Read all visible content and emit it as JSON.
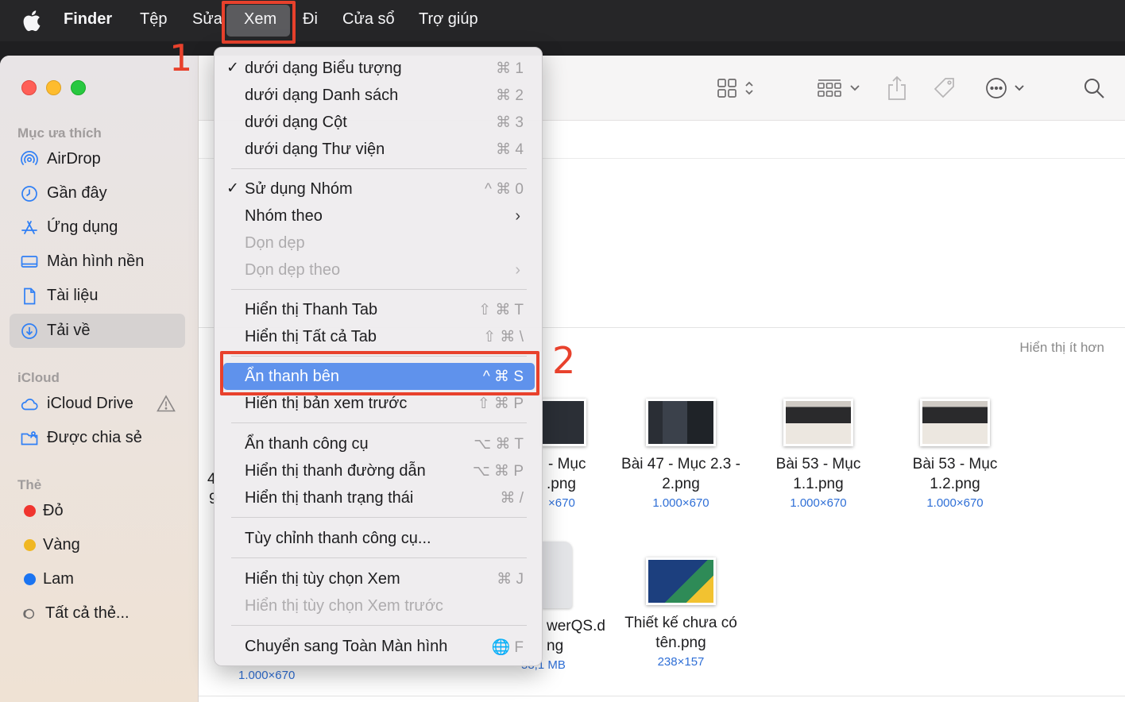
{
  "menubar": {
    "app": "Finder",
    "items": [
      "Tệp",
      "Sửa",
      "Xem",
      "Đi",
      "Cửa sổ",
      "Trợ giúp"
    ]
  },
  "annotations": {
    "step1": "1",
    "step2": "2",
    "accent_color": "#e8412c"
  },
  "sidebar": {
    "favorites_title": "Mục ưa thích",
    "favorites": [
      {
        "label": "AirDrop",
        "icon": "airdrop-icon"
      },
      {
        "label": "Gần đây",
        "icon": "clock-icon"
      },
      {
        "label": "Ứng dụng",
        "icon": "applications-icon"
      },
      {
        "label": "Màn hình nền",
        "icon": "desktop-icon"
      },
      {
        "label": "Tài liệu",
        "icon": "document-icon"
      },
      {
        "label": "Tải về",
        "icon": "download-icon",
        "selected": true
      }
    ],
    "icloud_title": "iCloud",
    "icloud": [
      {
        "label": "iCloud Drive",
        "icon": "cloud-icon"
      },
      {
        "label": "Được chia sẻ",
        "icon": "shared-folder-icon"
      }
    ],
    "tags_title": "Thẻ",
    "tags": [
      {
        "label": "Đỏ",
        "color": "#f0352f"
      },
      {
        "label": "Vàng",
        "color": "#f0b722"
      },
      {
        "label": "Lam",
        "color": "#1b74f1"
      },
      {
        "label": "Tất cả thẻ...",
        "color": ""
      }
    ]
  },
  "main": {
    "show_less": "Hiển thị ít hơn",
    "files_row1": [
      {
        "name1": "- Mục",
        "name2": ".png",
        "dim": "×670"
      },
      {
        "name1": "Bài 47 - Mục 2.3 -",
        "name2": "2.png",
        "dim": "1.000×670"
      },
      {
        "name1": "Bài 53 - Mục",
        "name2": "1.1.png",
        "dim": "1.000×670"
      },
      {
        "name1": "Bài 53 - Mục",
        "name2": "1.2.png",
        "dim": "1.000×670"
      }
    ],
    "files_row2": [
      {
        "name1": "",
        "name2": "",
        "dim": "1.000×670"
      },
      {
        "name1": "werQS.d",
        "name2": "ng",
        "dim": "58,1 MB"
      },
      {
        "name1": "Thiết kế chưa có",
        "name2": "tên.png",
        "dim": "238×157"
      }
    ],
    "partial_left_chars": [
      "4",
      "9"
    ]
  },
  "view_menu": {
    "items": [
      {
        "label": "dưới dạng Biểu tượng",
        "shortcut": "⌘ 1",
        "checked": true
      },
      {
        "label": "dưới dạng Danh sách",
        "shortcut": "⌘ 2"
      },
      {
        "label": "dưới dạng Cột",
        "shortcut": "⌘ 3"
      },
      {
        "label": "dưới dạng Thư viện",
        "shortcut": "⌘ 4"
      },
      {
        "label": "Sử dụng Nhóm",
        "shortcut": "^ ⌘ 0",
        "checked": true
      },
      {
        "label": "Nhóm theo",
        "shortcut": "",
        "submenu": true
      },
      {
        "label": "Dọn dẹp",
        "shortcut": "",
        "disabled": true
      },
      {
        "label": "Dọn dẹp theo",
        "shortcut": "",
        "disabled": true,
        "submenu": true
      },
      {
        "label": "Hiển thị Thanh Tab",
        "shortcut": "⇧ ⌘ T"
      },
      {
        "label": "Hiển thị Tất cả Tab",
        "shortcut": "⇧ ⌘ \\"
      },
      {
        "label": "Ẩn thanh bên",
        "shortcut": "^ ⌘ S",
        "highlighted": true
      },
      {
        "label": "Hiển thị bản xem trước",
        "shortcut": "⇧ ⌘ P"
      },
      {
        "label": "Ẩn thanh công cụ",
        "shortcut": "⌥ ⌘ T"
      },
      {
        "label": "Hiển thị thanh đường dẫn",
        "shortcut": "⌥ ⌘ P"
      },
      {
        "label": "Hiển thị thanh trạng thái",
        "shortcut": "⌘ /"
      },
      {
        "label": "Tùy chỉnh thanh công cụ...",
        "shortcut": ""
      },
      {
        "label": "Hiển thị tùy chọn Xem",
        "shortcut": "⌘ J"
      },
      {
        "label": "Hiển thị tùy chọn Xem trước",
        "shortcut": "",
        "disabled": true
      },
      {
        "label": "Chuyển sang Toàn Màn hình",
        "shortcut": "🌐 F"
      }
    ]
  },
  "colors": {
    "highlight": "#5f92ec",
    "link_blue": "#2f6fd6"
  }
}
